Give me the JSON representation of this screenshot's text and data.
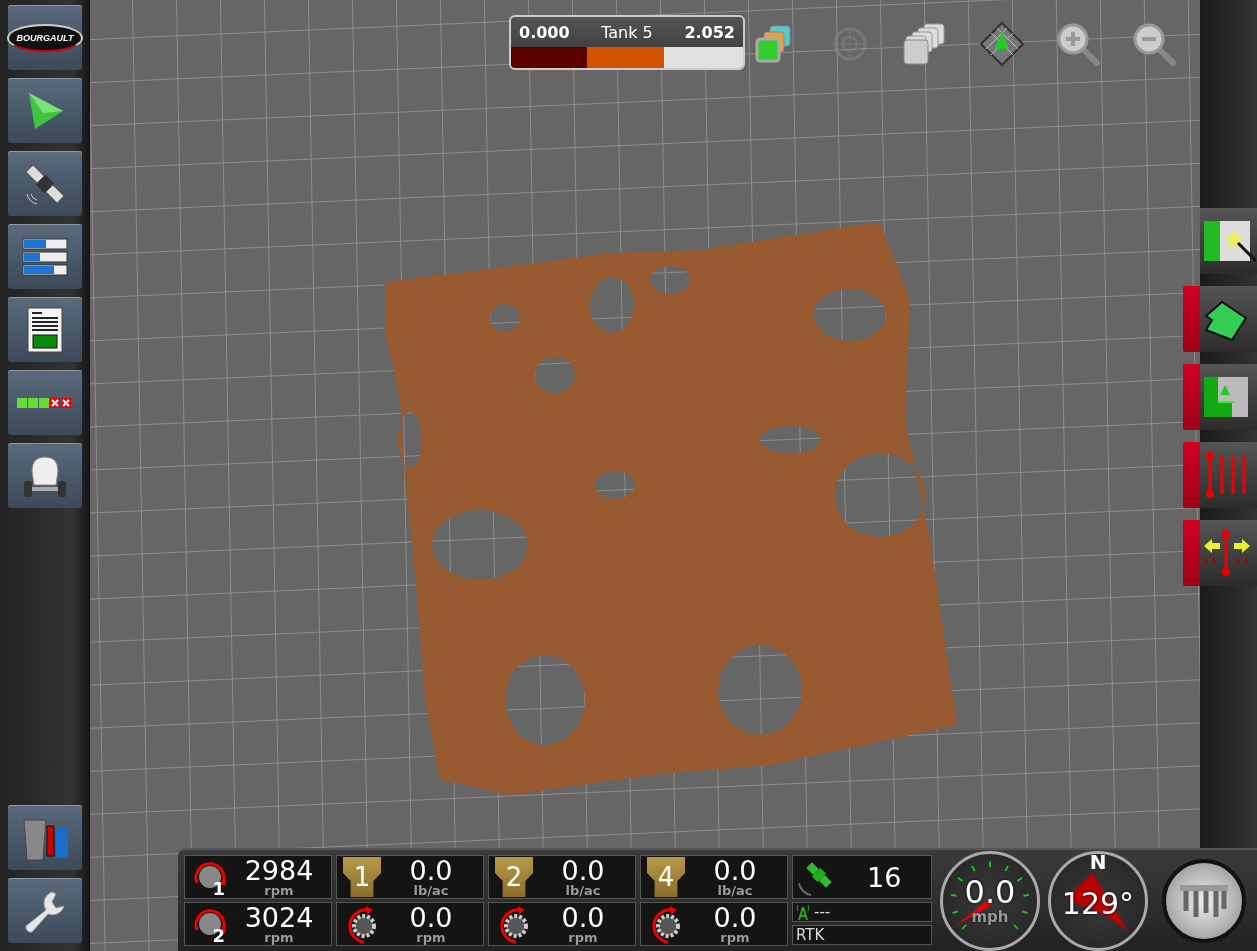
{
  "sidebar": {
    "items": [
      {
        "kind": "logo",
        "text": "BOURGAULT"
      },
      {
        "kind": "guidance"
      },
      {
        "kind": "satellite"
      },
      {
        "kind": "bars"
      },
      {
        "kind": "report"
      },
      {
        "kind": "sections"
      },
      {
        "kind": "cart"
      }
    ],
    "bottom_items": [
      {
        "kind": "trash"
      },
      {
        "kind": "wrench"
      }
    ]
  },
  "tank_gauge": {
    "min": "0.000",
    "label": "Tank 5",
    "max": "2.052",
    "level": 0.66
  },
  "toolbar": [
    {
      "kind": "layers",
      "disabled": false
    },
    {
      "kind": "target",
      "disabled": true
    },
    {
      "kind": "stack",
      "disabled": false
    },
    {
      "kind": "grid",
      "disabled": false
    },
    {
      "kind": "zoom_in",
      "disabled": false
    },
    {
      "kind": "zoom_out",
      "disabled": false
    }
  ],
  "right_buttons": [
    {
      "kind": "wand",
      "marked": false
    },
    {
      "kind": "boundary",
      "marked": true
    },
    {
      "kind": "headland",
      "marked": true
    },
    {
      "kind": "lines",
      "marked": true
    },
    {
      "kind": "shift",
      "marked": true
    }
  ],
  "fans": [
    {
      "badge": "1",
      "value": "2984",
      "unit": "rpm"
    },
    {
      "badge": "2",
      "value": "3024",
      "unit": "rpm"
    }
  ],
  "tanks": [
    {
      "number": "1",
      "rate": "0.0",
      "rate_unit": "lb/ac",
      "meter": "0.0",
      "meter_unit": "rpm"
    },
    {
      "number": "2",
      "rate": "0.0",
      "rate_unit": "lb/ac",
      "meter": "0.0",
      "meter_unit": "rpm"
    },
    {
      "number": "4",
      "rate": "0.0",
      "rate_unit": "lb/ac",
      "meter": "0.0",
      "meter_unit": "rpm"
    }
  ],
  "gps": {
    "satellites": "16",
    "signal": "---",
    "mode": "RTK"
  },
  "speed": {
    "value": "0.0",
    "unit": "mph"
  },
  "heading": {
    "north": "N",
    "value": "129°"
  }
}
